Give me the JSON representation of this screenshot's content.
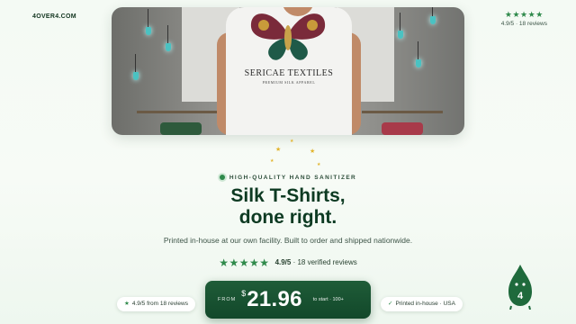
{
  "brand": "4OVER4.COM",
  "top_rating": {
    "stars": "★★★★★",
    "text": "4.9/5 · 18 reviews"
  },
  "hero": {
    "shirt_brand": "SERICAE TEXTILES",
    "shirt_tagline": "PREMIUM SILK APPAREL"
  },
  "eyebrow": "HIGH-QUALITY HAND SANITIZER",
  "headline": {
    "line1": "Silk T-Shirts,",
    "line2": "done right."
  },
  "subtext": "Printed in-house at our own facility. Built to order and shipped nationwide.",
  "reviews": {
    "stars": "★★★★★",
    "score": "4.9/5",
    "count": "· 18 verified reviews"
  },
  "chips": {
    "left": "4.9/5 from 18 reviews",
    "right": "Printed in-house · USA"
  },
  "price_cta": {
    "from": "FROM",
    "currency": "$",
    "amount": "21.96",
    "tail": "to start · 100+"
  },
  "mascot": {
    "label": "4"
  },
  "colors": {
    "accent": "#2f8a4b",
    "cta": "#1a5232",
    "heading": "#0d3a22"
  },
  "icons": [
    "star-icon",
    "check-icon",
    "sparkle-icon",
    "mascot-drop-icon"
  ]
}
